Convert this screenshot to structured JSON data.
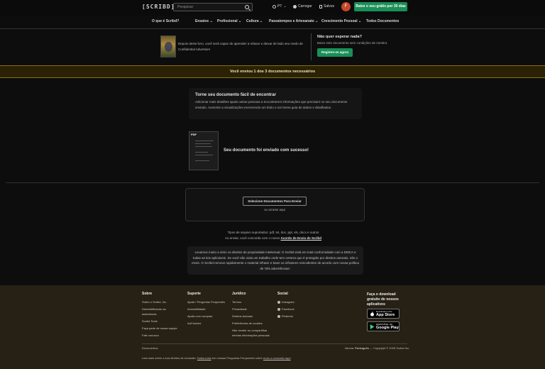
{
  "header": {
    "logo": "[SCRIBD]",
    "search_placeholder": "Pesquisar",
    "lang": "PT",
    "login": "Carregar",
    "saved": "Salvos",
    "avatar_letter": "F",
    "cta": "Baixe o seu grátis por 30 dias"
  },
  "nav": {
    "items": [
      "O que é Scribd?",
      "Ensaios",
      "Profissional",
      "Cultura",
      "Passatempos e Artesanato",
      "Crescimento Pessoal",
      "Todos Documentos"
    ]
  },
  "book": {
    "description": "Depois deste livro, você será capaz de aprender a relaxar e deixar de lado seu medo de",
    "description2": "Confidential Adventure"
  },
  "nowait": {
    "title": "Não quer esperar nada?",
    "subtitle": "Baixe este documento sem condições de mentira",
    "button": "Registre-se agora"
  },
  "banner": {
    "text": "Você enviou 1 dos 3 documentos necessários"
  },
  "tip": {
    "title": "Torne seu documento fácil de encontrar",
    "body": "Adicionar mais detalhes ajuda outras pessoas a encontrarem informações que precisam no seu documento enviado. Aumente a visualizações escrevendo um título e um breve guia de dados e detalhados."
  },
  "upload": {
    "pdf_tag": "PDF",
    "success": "Seu documento foi enviado com sucesso!",
    "select_button": "Selecione Documentos Para Enviar",
    "or_drag": "ou arraste aqui"
  },
  "types": {
    "line1": "Tipos de arquivo suportados: pdf, txt, doc, ppt, xls, docx e outros",
    "line2_prefix": "Ao enviar, você concorda com o nosso ",
    "line2_link": "Acordo de Envio de Scribd"
  },
  "ip_notice": {
    "text": "Levamos muito a sério os direitos de propriedade intelectual. O Scribd está em total conformidade com a DMCA e todas as leis aplicáveis. Se você não viola um trabalho onde tem certeza que é protegido por direitos autorais, não o envie. O Scribd remove rapidamente o material infrator e bane os infratores reincidentes de acordo com nossa política de 'três advertências'."
  },
  "footer": {
    "about": {
      "title": "Sobre",
      "links": [
        "Sobre o Scribd, Inc.",
        "Desmistificando as assinaturas",
        "Scribd Teste",
        "Faça parte de nossa equipe",
        "Fale conosco"
      ]
    },
    "support": {
      "title": "Suporte",
      "links": [
        "Ajuda / Perguntas Frequentes",
        "Acessibilidade",
        "Ajuda com compras",
        "AdChoices"
      ]
    },
    "legal": {
      "title": "Jurídico",
      "links": [
        "Termos",
        "Privacidade",
        "Direitos Autorais",
        "Preferências de cookies",
        "Não vender ou compartilhar minhas informações pessoais"
      ]
    },
    "social": {
      "title": "Social",
      "links": [
        "Instagram",
        "Facebook",
        "Pinterest"
      ]
    },
    "apps": {
      "title": "Faça o download gratuito de nossos aplicativos",
      "appstore_top": "Download on the",
      "appstore": "App Store",
      "googleplay_top": "DISPONÍVEL NO",
      "googleplay": "Google Play"
    },
    "docs": "Documentos",
    "language_label": "Idioma: ",
    "language_value": "Português",
    "copyright": "Copyright © 2026 Scribd Inc.",
    "bottom_prefix": "Leia mais sobre a sua direitos de exclusão: ",
    "bottom_link1": "Saiba mais",
    "bottom_mid": " em nossas Perguntas Frequentes sobre ",
    "bottom_link2": "envio e exclusão aqui"
  },
  "colors": {
    "accent": "#1a8f57",
    "banner_bg": "#2b2205",
    "footer_bg": "#262114",
    "avatar": "#c7472a"
  }
}
